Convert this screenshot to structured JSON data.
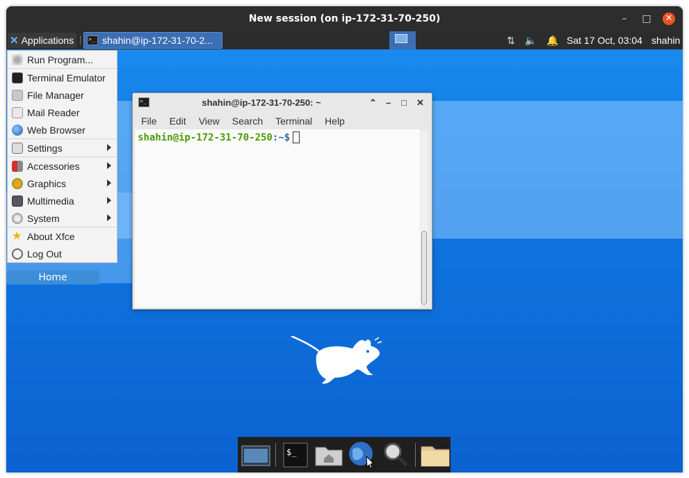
{
  "window": {
    "title": "New session (on ip-172-31-70-250)",
    "min_glyph": "–",
    "max_glyph": "□",
    "close_glyph": "✕"
  },
  "panel": {
    "apps_label": "Applications",
    "task_label": "shahin@ip-172-31-70-2...",
    "clock": "Sat 17 Oct, 03:04",
    "user": "shahin",
    "tray_icons": [
      "network-icon",
      "volume-muted-icon",
      "notification-bell-icon"
    ]
  },
  "menu": {
    "items": [
      {
        "label": "Run Program...",
        "icon": "run-program-icon"
      },
      {
        "label": "Terminal Emulator",
        "icon": "terminal-icon"
      },
      {
        "label": "File Manager",
        "icon": "folder-icon"
      },
      {
        "label": "Mail Reader",
        "icon": "mail-icon"
      },
      {
        "label": "Web Browser",
        "icon": "globe-icon"
      },
      {
        "label": "Settings",
        "icon": "settings-icon",
        "submenu": true
      },
      {
        "label": "Accessories",
        "icon": "accessories-icon",
        "submenu": true
      },
      {
        "label": "Graphics",
        "icon": "graphics-icon",
        "submenu": true
      },
      {
        "label": "Multimedia",
        "icon": "multimedia-icon",
        "submenu": true
      },
      {
        "label": "System",
        "icon": "system-gear-icon",
        "submenu": true
      },
      {
        "label": "About Xfce",
        "icon": "star-icon"
      },
      {
        "label": "Log Out",
        "icon": "power-icon"
      }
    ]
  },
  "desktop": {
    "home_label": "Home"
  },
  "terminal": {
    "title": "shahin@ip-172-31-70-250: ~",
    "menu": [
      "File",
      "Edit",
      "View",
      "Search",
      "Terminal",
      "Help"
    ],
    "prompt_user": "shahin@ip-172-31-70-250",
    "prompt_path": ":~$"
  },
  "dock": {
    "items": [
      "show-desktop-icon",
      "terminal-icon",
      "home-folder-icon",
      "web-browser-icon",
      "search-icon",
      "file-manager-icon"
    ]
  },
  "colors": {
    "desktop_blue": "#0f75e0",
    "panel": "#2c2c2c",
    "task_active": "#3c6eb4",
    "close_orange": "#e95420",
    "prompt_green": "#4e9a06",
    "prompt_blue": "#3465a4"
  }
}
